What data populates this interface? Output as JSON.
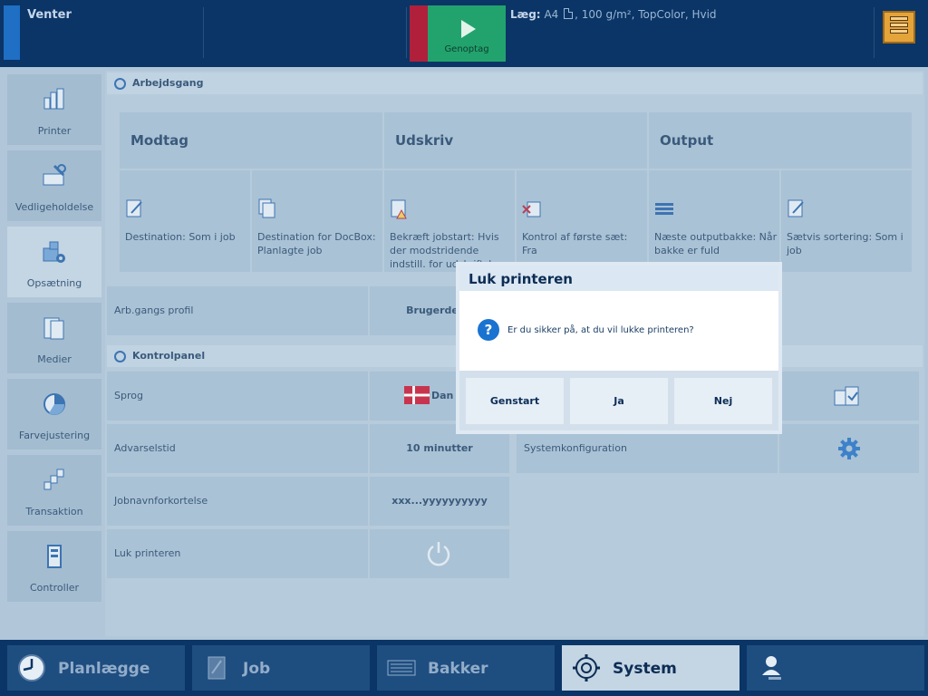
{
  "topbar": {
    "status": "Venter",
    "resume_label": "Genoptag",
    "load_label": "Læg:",
    "load_size": "A4",
    "load_details": ", 100 g/m², TopColor, Hvid"
  },
  "sidebar": {
    "items": [
      {
        "label": "Printer",
        "icon": "printer-icon"
      },
      {
        "label": "Vedligeholdelse",
        "icon": "maintenance-icon"
      },
      {
        "label": "Opsætning",
        "icon": "setup-icon"
      },
      {
        "label": "Medier",
        "icon": "media-icon"
      },
      {
        "label": "Farvejustering",
        "icon": "color-adjust-icon"
      },
      {
        "label": "Transaktion",
        "icon": "transaction-icon"
      },
      {
        "label": "Controller",
        "icon": "controller-icon"
      }
    ],
    "active": "Opsætning"
  },
  "workflow": {
    "title": "Arbejdsgang",
    "columns": [
      "Modtag",
      "Udskriv",
      "Output"
    ],
    "cards": [
      "Destination: Som i job",
      "Destination for DocBox: Planlagte job",
      "Bekræft jobstart: Hvis der modstridende indstill. for udskriftskv.",
      "Kontrol af første sæt: Fra",
      "Næste outputbakke: Når bakke er fuld",
      "Sætvis sortering: Som i job"
    ],
    "profile_label": "Arb.gangs profil",
    "profile_value": "Brugerdefin"
  },
  "controlpanel": {
    "title": "Kontrolpanel",
    "language_label": "Sprog",
    "language_value": "Dan",
    "warning_label": "Advarselstid",
    "warning_value": "10 minutter",
    "jobabbr_label": "Jobnavnforkortelse",
    "jobabbr_value": "xxx...yyyyyyyyyy",
    "shutdown_label": "Luk printeren",
    "sysconfig_label": "Systemkonfiguration"
  },
  "dialog": {
    "title": "Luk printeren",
    "message": "Er du sikker på, at du vil lukke printeren?",
    "buttons": [
      "Genstart",
      "Ja",
      "Nej"
    ]
  },
  "bottomnav": {
    "items": [
      "Planlægge",
      "Job",
      "Bakker",
      "System"
    ],
    "active": "System"
  },
  "colors": {
    "accent_blue": "#1f6fc4",
    "resume_green": "#22a36e",
    "stop_red": "#b0203a",
    "question_blue": "#1a73d0"
  }
}
